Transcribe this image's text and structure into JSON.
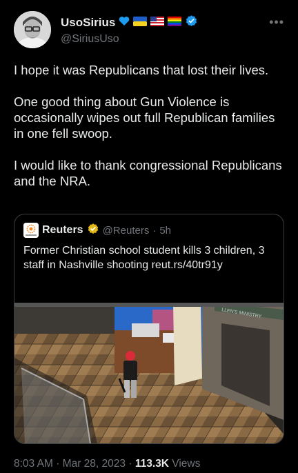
{
  "tweet": {
    "display_name": "UsoSirius",
    "handle": "@SiriusUso",
    "more_icon": "more-horizontal-icon",
    "paragraphs": [
      "I hope it was Republicans that lost their lives.",
      "One good thing about Gun Violence is occasionally wipes out full Republican families in one fell swoop.",
      "I would like to thank congressional Republicans and the NRA."
    ],
    "badges": [
      "heart-emoji",
      "ukraine-flag",
      "us-flag",
      "rainbow-flag",
      "verified-badge"
    ]
  },
  "quote": {
    "display_name": "Reuters",
    "handle": "@Reuters",
    "separator": "·",
    "time_ago": "5h",
    "text": "Former Christian school student kills 3 children, 3 staff in Nashville shooting reut.rs/40tr91y",
    "media_overlay_text": "LLEN'S MINISTRY"
  },
  "meta": {
    "time": "8:03 AM",
    "separator": "·",
    "date": "Mar 28, 2023",
    "views_count": "113.3K",
    "views_label": "Views"
  },
  "colors": {
    "background": "#000000",
    "text": "#e7e9ea",
    "muted": "#71767b",
    "verified_blue": "#1d9bf0",
    "gold_verified": "#e2b719",
    "border": "#3a3f44"
  }
}
